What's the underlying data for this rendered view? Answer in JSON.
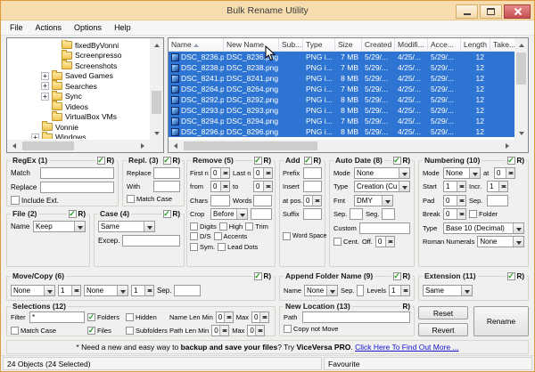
{
  "window": {
    "title": "Bulk Rename Utility"
  },
  "menu": {
    "file": "File",
    "actions": "Actions",
    "options": "Options",
    "help": "Help"
  },
  "tree": {
    "items": [
      {
        "label": "fixedByVonni",
        "indent": 4,
        "exp": ""
      },
      {
        "label": "Screenpresso",
        "indent": 4,
        "exp": ""
      },
      {
        "label": "Screenshots",
        "indent": 4,
        "exp": ""
      },
      {
        "label": "Saved Games",
        "indent": 3,
        "exp": "+"
      },
      {
        "label": "Searches",
        "indent": 3,
        "exp": "+"
      },
      {
        "label": "Sync",
        "indent": 3,
        "exp": "+"
      },
      {
        "label": "Videos",
        "indent": 3,
        "exp": ""
      },
      {
        "label": "VirtualBox VMs",
        "indent": 3,
        "exp": ""
      },
      {
        "label": "Vonnie",
        "indent": 2,
        "exp": ""
      },
      {
        "label": "Windows",
        "indent": 2,
        "exp": "+"
      }
    ]
  },
  "filelist": {
    "columns": {
      "name": "Name",
      "new_name": "New Name",
      "sub": "Sub...",
      "type": "Type",
      "size": "Size",
      "created": "Created",
      "modified": "Modifi...",
      "accessed": "Acce...",
      "length": "Length",
      "taken": "Take..."
    },
    "rows": [
      {
        "name": "DSC_8236.png",
        "new_name": "DSC_8236.png",
        "sub": "",
        "type": "PNG i...",
        "size": "7 MB",
        "created": "5/29/...",
        "modified": "4/25/...",
        "accessed": "5/29/...",
        "length": "12",
        "taken": ""
      },
      {
        "name": "DSC_8238.png",
        "new_name": "DSC_8238.png",
        "sub": "",
        "type": "PNG i...",
        "size": "7 MB",
        "created": "5/29/...",
        "modified": "4/25/...",
        "accessed": "5/29/...",
        "length": "12",
        "taken": ""
      },
      {
        "name": "DSC_8241.png",
        "new_name": "DSC_8241.png",
        "sub": "",
        "type": "PNG i...",
        "size": "8 MB",
        "created": "5/29/...",
        "modified": "4/25/...",
        "accessed": "5/29/...",
        "length": "12",
        "taken": ""
      },
      {
        "name": "DSC_8264.png",
        "new_name": "DSC_8264.png",
        "sub": "",
        "type": "PNG i...",
        "size": "7 MB",
        "created": "5/29/...",
        "modified": "4/25/...",
        "accessed": "5/29/...",
        "length": "12",
        "taken": ""
      },
      {
        "name": "DSC_8292.png",
        "new_name": "DSC_8292.png",
        "sub": "",
        "type": "PNG i...",
        "size": "8 MB",
        "created": "5/29/...",
        "modified": "4/25/...",
        "accessed": "5/29/...",
        "length": "12",
        "taken": ""
      },
      {
        "name": "DSC_8293.png",
        "new_name": "DSC_8293.png",
        "sub": "",
        "type": "PNG i...",
        "size": "8 MB",
        "created": "5/29/...",
        "modified": "4/25/...",
        "accessed": "5/29/...",
        "length": "12",
        "taken": ""
      },
      {
        "name": "DSC_8294.png",
        "new_name": "DSC_8294.png",
        "sub": "",
        "type": "PNG i...",
        "size": "7 MB",
        "created": "5/29/...",
        "modified": "4/25/...",
        "accessed": "5/29/...",
        "length": "12",
        "taken": ""
      },
      {
        "name": "DSC_8296.png",
        "new_name": "DSC_8296.png",
        "sub": "",
        "type": "PNG i...",
        "size": "8 MB",
        "created": "5/29/...",
        "modified": "4/25/...",
        "accessed": "5/29/...",
        "length": "12",
        "taken": ""
      }
    ]
  },
  "groups": {
    "regex": {
      "title": "RegEx (1)",
      "r": "R)",
      "on": true,
      "match_label": "Match",
      "match": "",
      "replace_label": "Replace",
      "replace": "",
      "include_ext_label": "Include Ext.",
      "include_ext": false
    },
    "repl": {
      "title": "Repl. (3)",
      "r": "R)",
      "on": true,
      "replace_label": "Replace",
      "replace": "",
      "with_label": "With",
      "with": "",
      "match_case_label": "Match Case",
      "match_case": false
    },
    "file": {
      "title": "File (2)",
      "r": "R)",
      "on": true,
      "name_label": "Name",
      "name": "Keep"
    },
    "case": {
      "title": "Case (4)",
      "r": "R)",
      "on": true,
      "mode": "Same",
      "excep_label": "Excep.",
      "excep": ""
    },
    "remove": {
      "title": "Remove (5)",
      "r": "R)",
      "on": true,
      "first_n_label": "First n",
      "first_n": "0",
      "last_n_label": "Last n",
      "last_n": "0",
      "from_label": "from",
      "from": "0",
      "to_label": "to",
      "to": "0",
      "chars_label": "Chars",
      "chars": "",
      "words_label": "Words",
      "words": "",
      "crop_label": "Crop",
      "crop_mode": "Before",
      "crop": "",
      "digits_label": "Digits",
      "digits": false,
      "high_label": "High",
      "high": false,
      "trim_label": "Trim",
      "trim": false,
      "ds_label": "D/S",
      "ds": false,
      "accents_label": "Accents",
      "accents": false,
      "sym_label": "Sym.",
      "sym": false,
      "lead_dots_label": "Lead Dots",
      "lead_dots": false
    },
    "add": {
      "title": "Add (7)",
      "r": "R)",
      "on": true,
      "prefix_label": "Prefix",
      "prefix": "",
      "insert_label": "Insert",
      "insert": "",
      "at_pos_label": "at pos.",
      "at_pos": "0",
      "suffix_label": "Suffix",
      "suffix": "",
      "word_space_label": "Word Space",
      "word_space": false
    },
    "autodate": {
      "title": "Auto Date (8)",
      "r": "R)",
      "on": true,
      "mode_label": "Mode",
      "mode": "None",
      "type_label": "Type",
      "type": "Creation (Cur",
      "fmt_label": "Fmt",
      "fmt": "DMY",
      "sep_label": "Sep.",
      "sep": "",
      "seg_label": "Seg.",
      "seg": "",
      "custom_label": "Custom",
      "custom": "",
      "cent_label": "Cent.",
      "cent": false,
      "off_label": "Off.",
      "off": "0"
    },
    "numbering": {
      "title": "Numbering (10)",
      "r": "R)",
      "on": true,
      "mode_label": "Mode",
      "mode": "None",
      "at_label": "at",
      "at": "0",
      "start_label": "Start",
      "start": "1",
      "incr_label": "Incr.",
      "incr": "1",
      "pad_label": "Pad",
      "pad": "0",
      "sep_label": "Sep.",
      "sep": "",
      "break_label": "Break",
      "break": "0",
      "folder_label": "Folder",
      "folder": false,
      "type_label": "Type",
      "type": "Base 10 (Decimal)",
      "roman_label": "Roman Numerals",
      "roman": "None"
    },
    "movecopy": {
      "title": "Move/Copy (6)",
      "r": "R)",
      "on": true,
      "mode1": "None",
      "n1": "1",
      "mode2": "None",
      "n2": "1",
      "sep_label": "Sep.",
      "sep": ""
    },
    "appendfolder": {
      "title": "Append Folder Name (9)",
      "r": "R)",
      "on": true,
      "name_label": "Name",
      "name": "None",
      "sep_label": "Sep.",
      "sep": "",
      "levels_label": "Levels",
      "levels": "1"
    },
    "extension": {
      "title": "Extension (11)",
      "r": "R)",
      "on": true,
      "mode": "Same"
    },
    "selections": {
      "title": "Selections (12)",
      "filter_label": "Filter",
      "filter": "*",
      "match_case_label": "Match Case",
      "match_case": false,
      "folders_label": "Folders",
      "folders": true,
      "files_label": "Files",
      "files": true,
      "hidden_label": "Hidden",
      "hidden": false,
      "subfolders_label": "Subfolders",
      "subfolders": false,
      "name_len_label": "Name Len Min",
      "name_min": "0",
      "max1_label": "Max",
      "name_max": "0",
      "path_len_label": "Path Len Min",
      "path_min": "0",
      "max2_label": "Max",
      "path_max": "0"
    },
    "newlocation": {
      "title": "New Location (13)",
      "r": "R)",
      "path_label": "Path",
      "path": "",
      "copy_label": "Copy not Move",
      "copy": false
    },
    "buttons": {
      "reset": "Reset",
      "revert": "Revert",
      "rename": "Rename"
    }
  },
  "footer": {
    "prefix": "* Need a new and easy way to ",
    "bold1": "backup and save your files",
    "mid": "? Try ",
    "bold2": "ViceVersa PRO",
    "sep": ". ",
    "link": "Click Here To Find Out More ..."
  },
  "statusbar": {
    "objects": "24 Objects (24 Selected)",
    "mode": "Favourite"
  }
}
